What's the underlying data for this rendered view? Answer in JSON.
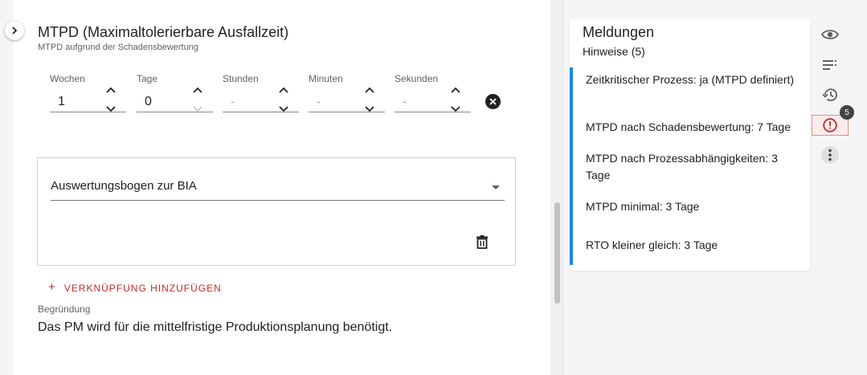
{
  "section": {
    "title": "MTPD (Maximaltolerierbare Ausfallzeit)",
    "subtitle": "MTPD aufgrund der Schadensbewertung"
  },
  "duration": {
    "fields": [
      {
        "label": "Wochen",
        "value": "1"
      },
      {
        "label": "Tage",
        "value": "0"
      },
      {
        "label": "Stunden",
        "value": "-"
      },
      {
        "label": "Minuten",
        "value": "-"
      },
      {
        "label": "Sekunden",
        "value": "-"
      }
    ]
  },
  "link_card": {
    "select_value": "Auswertungsbogen zur BIA"
  },
  "add_link_label": "VERKNÜPFUNG HINZUFÜGEN",
  "reason": {
    "label": "Begründung",
    "text": "Das PM wird für die mittelfristige Produktionsplanung benötigt."
  },
  "messages": {
    "title": "Meldungen",
    "subtitle": "Hinweise (5)",
    "items": [
      "Zeitkritischer Prozess: ja (MTPD definiert)",
      "MTPD nach Schadensbewertung: 7 Tage",
      "MTPD nach Prozessabhängigkeiten: 3 Tage",
      "MTPD minimal: 3 Tage",
      "RTO kleiner gleich: 3 Tage"
    ]
  },
  "sidebar": {
    "icons": [
      "eye-icon",
      "list-icon",
      "history-icon",
      "info-icon",
      "more-vert-icon"
    ],
    "badge": "5"
  },
  "colors": {
    "accent_red": "#c62828",
    "accent_blue": "#1e88e5"
  }
}
